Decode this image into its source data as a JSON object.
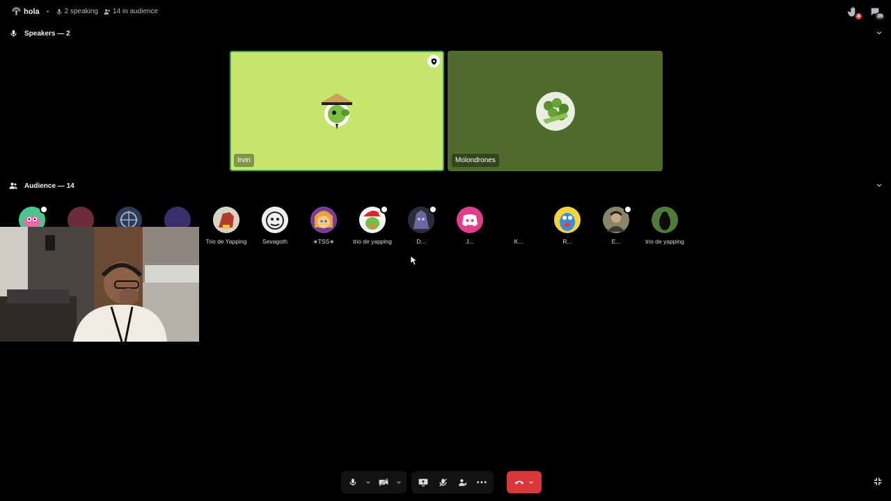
{
  "topbar": {
    "channel_name": "hola",
    "speaking": "2 speaking",
    "audience_count": "14 in audience",
    "raised_hands_badge": "4",
    "inbox_badge": "36"
  },
  "speakers": {
    "header": "Speakers — 2",
    "tiles": [
      {
        "name": "Irvin",
        "bg": "#c6e66e"
      },
      {
        "name": "Molondrones",
        "bg": "#4f6b2c"
      }
    ]
  },
  "audience": {
    "header": "Audience — 14",
    "members": [
      {
        "label": "",
        "color": "#48c58f"
      },
      {
        "label": "",
        "color": "#6c2c3b"
      },
      {
        "label": "",
        "color": "#2e3b55"
      },
      {
        "label": "",
        "color": "#3b2f6b"
      },
      {
        "label": "Trio de Yapping",
        "color": "#b33a2e"
      },
      {
        "label": "Sevagoth",
        "color": "#e8e8e8"
      },
      {
        "label": "∗TSS∗",
        "color": "#e9a33b"
      },
      {
        "label": "trio de yapping",
        "color": "#3b8a3b"
      },
      {
        "label": "D...",
        "color": "#4a4a6a"
      },
      {
        "label": "J...",
        "color": "#e03d8a"
      },
      {
        "label": "K...",
        "color": "#000000"
      },
      {
        "label": "R...",
        "color": "#3d8be0"
      },
      {
        "label": "E...",
        "color": "#6b6248"
      },
      {
        "label": "trio de yapping",
        "color": "#2d4a22"
      }
    ]
  },
  "colors": {
    "hangup": "#da373c",
    "active_speaker_border": "#3ba55d",
    "discord_blurple": "#e03d8a"
  }
}
